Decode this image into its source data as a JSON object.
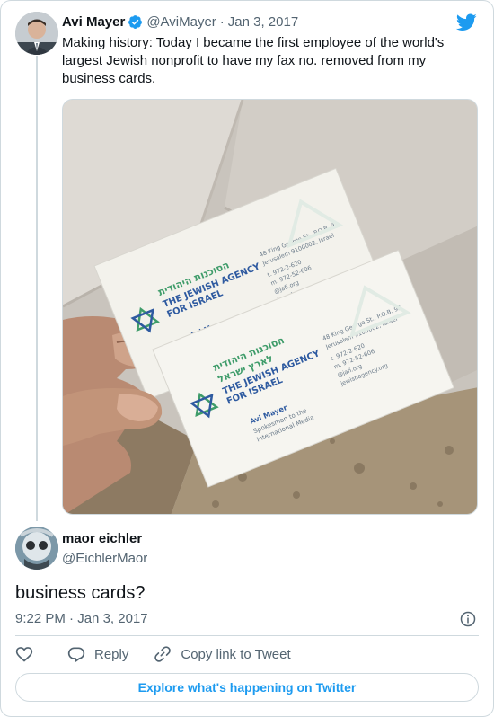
{
  "tweet": {
    "author_name": "Avi Mayer",
    "handle": "@AviMayer",
    "separator": "·",
    "date": "Jan 3, 2017",
    "text": "Making history: Today I became the first employee of the world's largest Jewish nonprofit to have my fax no. removed from my business cards."
  },
  "card": {
    "hebrew_line1": "הסוכנות היהודית",
    "hebrew_line2": "לארץ ישראל",
    "org_line1": "THE JEWISH AGENCY",
    "org_line2": "FOR ISRAEL",
    "person": "Avi Mayer",
    "role_line1": "Spokesman to the",
    "role_line2": "International Media",
    "addr_line1": "48 King George St., P.O.B. 92",
    "addr_line2": "Jerusalem 9100002, Israel",
    "addr_line3": "t. 972-2-620",
    "addr_line4": "m. 972-52-606",
    "addr_line5": "@jafi.org",
    "addr_line6": "jewishagency.org"
  },
  "reply": {
    "author_name": "maor eichler",
    "handle": "@EichlerMaor",
    "text": "business cards?",
    "time": "9:22 PM",
    "separator": "·",
    "date": "Jan 3, 2017"
  },
  "actions": {
    "reply_label": "Reply",
    "copy_label": "Copy link to Tweet"
  },
  "explore_label": "Explore what's happening on Twitter",
  "colors": {
    "accent": "#1d9bf0",
    "secondary_text": "#536471",
    "border": "#cfd9de"
  },
  "icons": [
    "verified-badge-icon",
    "twitter-bird-icon",
    "info-icon",
    "heart-icon",
    "reply-icon",
    "link-icon"
  ]
}
